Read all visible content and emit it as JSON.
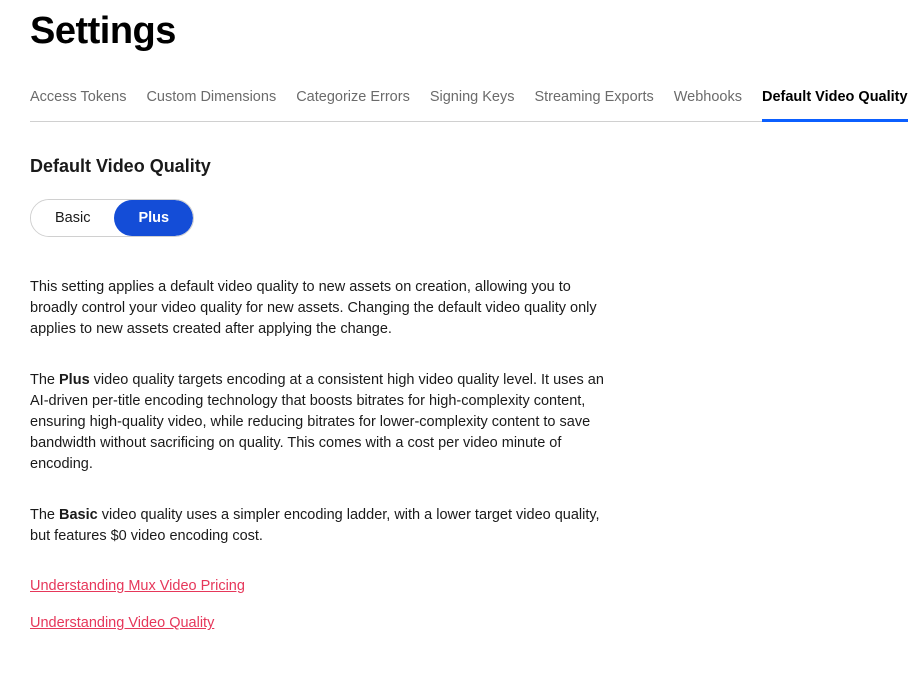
{
  "page": {
    "title": "Settings",
    "section_title": "Default Video Quality"
  },
  "tabs": [
    {
      "label": "Access Tokens"
    },
    {
      "label": "Custom Dimensions"
    },
    {
      "label": "Categorize Errors"
    },
    {
      "label": "Signing Keys"
    },
    {
      "label": "Streaming Exports"
    },
    {
      "label": "Webhooks"
    },
    {
      "label": "Default Video Quality",
      "active": true
    }
  ],
  "quality_toggle": {
    "options": [
      "Basic",
      "Plus"
    ],
    "selected": "Plus"
  },
  "paragraphs": {
    "intro": "This setting applies a default video quality to new assets on creation, allowing you to broadly control your video quality for new assets. Changing the default video quality only applies to new assets created after applying the change.",
    "plus_pre": "The ",
    "plus_bold": "Plus",
    "plus_post": " video quality targets encoding at a consistent high video quality level. It uses an AI-driven per-title encoding technology that boosts bitrates for high-complexity content, ensuring high-quality video, while reducing bitrates for lower-complexity content to save bandwidth without sacrificing on quality. This comes with a cost per video minute of encoding.",
    "basic_pre": "The ",
    "basic_bold": "Basic",
    "basic_post": " video quality uses a simpler encoding ladder, with a lower target video quality, but features $0 video encoding cost."
  },
  "links": {
    "pricing": "Understanding Mux Video Pricing",
    "quality": "Understanding Video Quality"
  }
}
